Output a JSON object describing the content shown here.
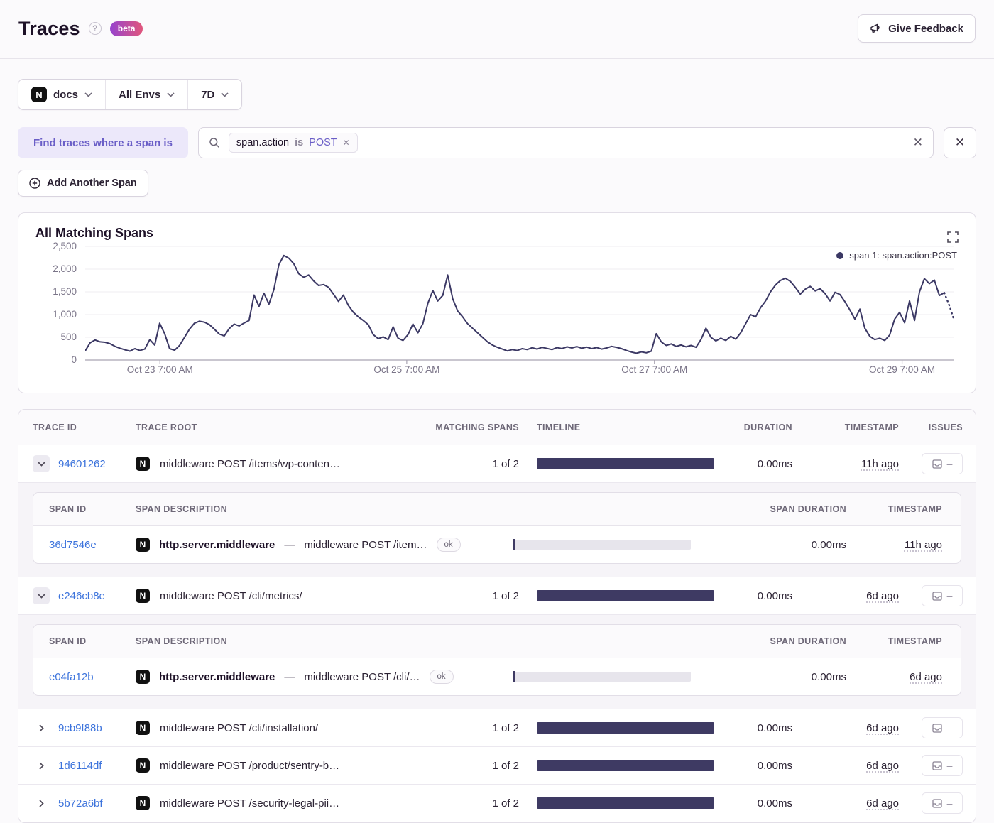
{
  "page": {
    "title": "Traces",
    "beta": "beta",
    "feedback": "Give Feedback"
  },
  "filters": {
    "project": "docs",
    "project_icon": "N",
    "environment": "All Envs",
    "date_range": "7D"
  },
  "span_query": {
    "label": "Find traces where a span is",
    "key": "span.action",
    "operator": "is",
    "value": "POST",
    "add_span": "Add Another Span"
  },
  "chart": {
    "title": "All Matching Spans",
    "legend": "span 1: span.action:POST"
  },
  "chart_data": {
    "type": "line",
    "title": "All Matching Spans",
    "legend_position": "top-right",
    "ylim": [
      0,
      2500
    ],
    "y_ticks": [
      0,
      500,
      1000,
      1500,
      2000,
      2500
    ],
    "y_tick_labels": [
      "0",
      "500",
      "1,000",
      "1,500",
      "2,000",
      "2,500"
    ],
    "x_tick_labels": [
      "Oct 23 7:00 AM",
      "Oct 25 7:00 AM",
      "Oct 27 7:00 AM",
      "Oct 29 7:00 AM"
    ],
    "x_tick_fractions": [
      0.086,
      0.37,
      0.655,
      0.94
    ],
    "grid": true,
    "line_color": "#3B3864",
    "dashed_tail_points": 3,
    "series": [
      {
        "name": "span 1: span.action:POST",
        "values": [
          200,
          380,
          440,
          400,
          390,
          360,
          300,
          260,
          225,
          195,
          250,
          210,
          240,
          450,
          330,
          810,
          580,
          250,
          215,
          320,
          500,
          680,
          810,
          855,
          835,
          780,
          680,
          570,
          530,
          690,
          790,
          750,
          815,
          870,
          1430,
          1180,
          1470,
          1230,
          1550,
          2100,
          2300,
          2240,
          2120,
          1900,
          1820,
          1870,
          1740,
          1640,
          1660,
          1600,
          1450,
          1290,
          1430,
          1200,
          1050,
          950,
          870,
          780,
          560,
          470,
          510,
          450,
          730,
          480,
          430,
          560,
          790,
          600,
          800,
          1250,
          1530,
          1300,
          1420,
          1870,
          1350,
          1080,
          950,
          800,
          700,
          600,
          500,
          400,
          330,
          280,
          240,
          200,
          230,
          210,
          250,
          230,
          270,
          240,
          280,
          255,
          230,
          275,
          250,
          290,
          265,
          295,
          260,
          285,
          250,
          275,
          240,
          265,
          300,
          280,
          250,
          210,
          175,
          150,
          180,
          160,
          195,
          580,
          400,
          320,
          355,
          300,
          330,
          290,
          320,
          280,
          450,
          700,
          500,
          420,
          480,
          430,
          520,
          460,
          600,
          800,
          1000,
          950,
          1150,
          1300,
          1500,
          1650,
          1750,
          1800,
          1730,
          1600,
          1450,
          1560,
          1620,
          1520,
          1570,
          1460,
          1300,
          1490,
          1440,
          1280,
          1100,
          900,
          1120,
          700,
          520,
          450,
          480,
          430,
          550,
          900,
          1050,
          820,
          1300,
          870,
          1500,
          1790,
          1680,
          1760,
          1420,
          1480,
          1200,
          870
        ]
      }
    ]
  },
  "table": {
    "columns": {
      "trace_id": "TRACE ID",
      "trace_root": "TRACE ROOT",
      "matching_spans": "MATCHING SPANS",
      "timeline": "TIMELINE",
      "duration": "DURATION",
      "timestamp": "TIMESTAMP",
      "issues": "ISSUES"
    },
    "span_columns": {
      "span_id": "SPAN ID",
      "span_description": "SPAN DESCRIPTION",
      "span_duration": "SPAN DURATION",
      "timestamp": "TIMESTAMP"
    },
    "rows": [
      {
        "trace_id": "94601262",
        "trace_root": "middleware POST /items/wp-conten…",
        "matching_spans": "1 of 2",
        "duration": "0.00ms",
        "timestamp": "11h ago",
        "issues": "–",
        "spans": [
          {
            "span_id": "36d7546e",
            "operation": "http.server.middleware",
            "separator": "—",
            "description": "middleware POST /item…",
            "status": "ok",
            "span_duration": "0.00ms",
            "timestamp": "11h ago"
          }
        ]
      },
      {
        "trace_id": "e246cb8e",
        "trace_root": "middleware POST /cli/metrics/",
        "matching_spans": "1 of 2",
        "duration": "0.00ms",
        "timestamp": "6d ago",
        "issues": "–",
        "spans": [
          {
            "span_id": "e04fa12b",
            "operation": "http.server.middleware",
            "separator": "—",
            "description": "middleware POST /cli/…",
            "status": "ok",
            "span_duration": "0.00ms",
            "timestamp": "6d ago"
          }
        ]
      },
      {
        "trace_id": "9cb9f88b",
        "trace_root": "middleware POST /cli/installation/",
        "matching_spans": "1 of 2",
        "duration": "0.00ms",
        "timestamp": "6d ago",
        "issues": "–"
      },
      {
        "trace_id": "1d6114df",
        "trace_root": "middleware POST /product/sentry-b…",
        "matching_spans": "1 of 2",
        "duration": "0.00ms",
        "timestamp": "6d ago",
        "issues": "–"
      },
      {
        "trace_id": "5b72a6bf",
        "trace_root": "middleware POST /security-legal-pii…",
        "matching_spans": "1 of 2",
        "duration": "0.00ms",
        "timestamp": "6d ago",
        "issues": "–"
      }
    ]
  },
  "colors": {
    "accent_purple": "#6A5EC7",
    "link_blue": "#3C73DC",
    "line_navy": "#3B3864",
    "beta_gradient": [
      "#9643CE",
      "#E1567C"
    ]
  }
}
